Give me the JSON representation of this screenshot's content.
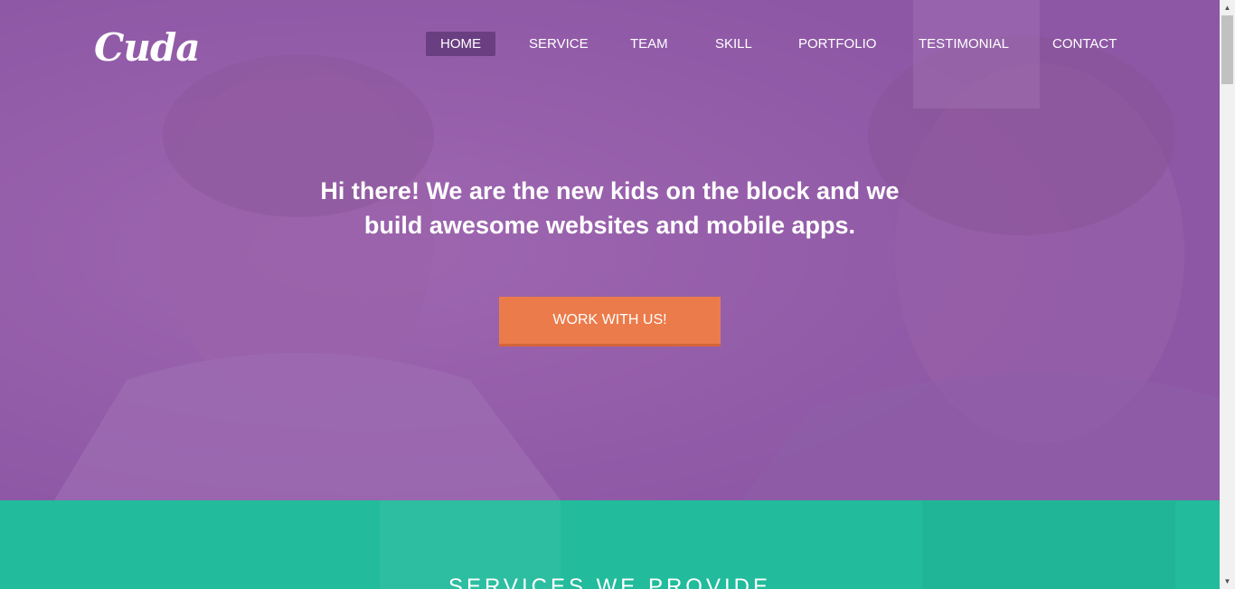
{
  "brand": {
    "logo_text": "Cuda"
  },
  "nav": {
    "items": [
      {
        "label": "HOME",
        "active": true
      },
      {
        "label": "SERVICE",
        "active": false
      },
      {
        "label": "TEAM",
        "active": false
      },
      {
        "label": "SKILL",
        "active": false
      },
      {
        "label": "PORTFOLIO",
        "active": false
      },
      {
        "label": "TESTIMONIAL",
        "active": false
      },
      {
        "label": "CONTACT",
        "active": false
      }
    ]
  },
  "hero": {
    "headline_line1": "Hi there! We are the new kids on the block and we",
    "headline_line2": "build awesome websites and mobile apps.",
    "cta_label": "WORK WITH US!"
  },
  "services": {
    "title": "SERVICES WE PROVIDE"
  },
  "colors": {
    "hero_overlay": "#9b63ab",
    "nav_active_bg": "#6a3f82",
    "cta": "#eb7b4a",
    "services_bg": "#22bb9c",
    "text": "#ffffff"
  },
  "scrollbar": {
    "up_icon": "triangle-up",
    "down_icon": "triangle-down"
  }
}
